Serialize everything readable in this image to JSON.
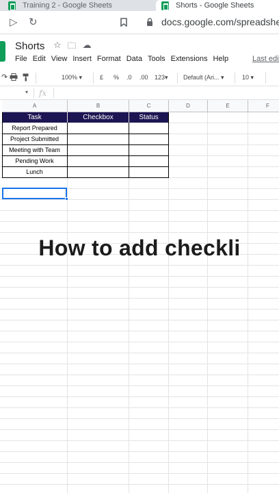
{
  "browser": {
    "tabs": [
      {
        "label": "Training 2 - Google Sheets"
      },
      {
        "label": "Shorts - Google Sheets"
      }
    ],
    "url": "docs.google.com/spreadsheet"
  },
  "doc": {
    "title": "Shorts",
    "menu": [
      "File",
      "Edit",
      "View",
      "Insert",
      "Format",
      "Data",
      "Tools",
      "Extensions",
      "Help"
    ],
    "last_edit": "Last edit"
  },
  "toolbar": {
    "zoom": "100%",
    "currency": "£",
    "percent": "%",
    "dec_decrease": ".0",
    "dec_increase": ".00",
    "more_formats": "123",
    "font": "Default (Ari...",
    "font_size": "10"
  },
  "formula": {
    "fx": "fx"
  },
  "columns": [
    "A",
    "B",
    "C",
    "D",
    "E",
    "F"
  ],
  "table": {
    "headers": [
      "Task",
      "Checkbox",
      "Status"
    ],
    "rows": [
      "Report Prepared",
      "Project Submitted",
      "Meeting with Team",
      "Pending Work",
      "Lunch"
    ]
  },
  "caption": "How to add checkli",
  "colors": {
    "header_bg": "#1c1653",
    "sheets_green": "#0f9d58",
    "selection_blue": "#1a73e8"
  }
}
